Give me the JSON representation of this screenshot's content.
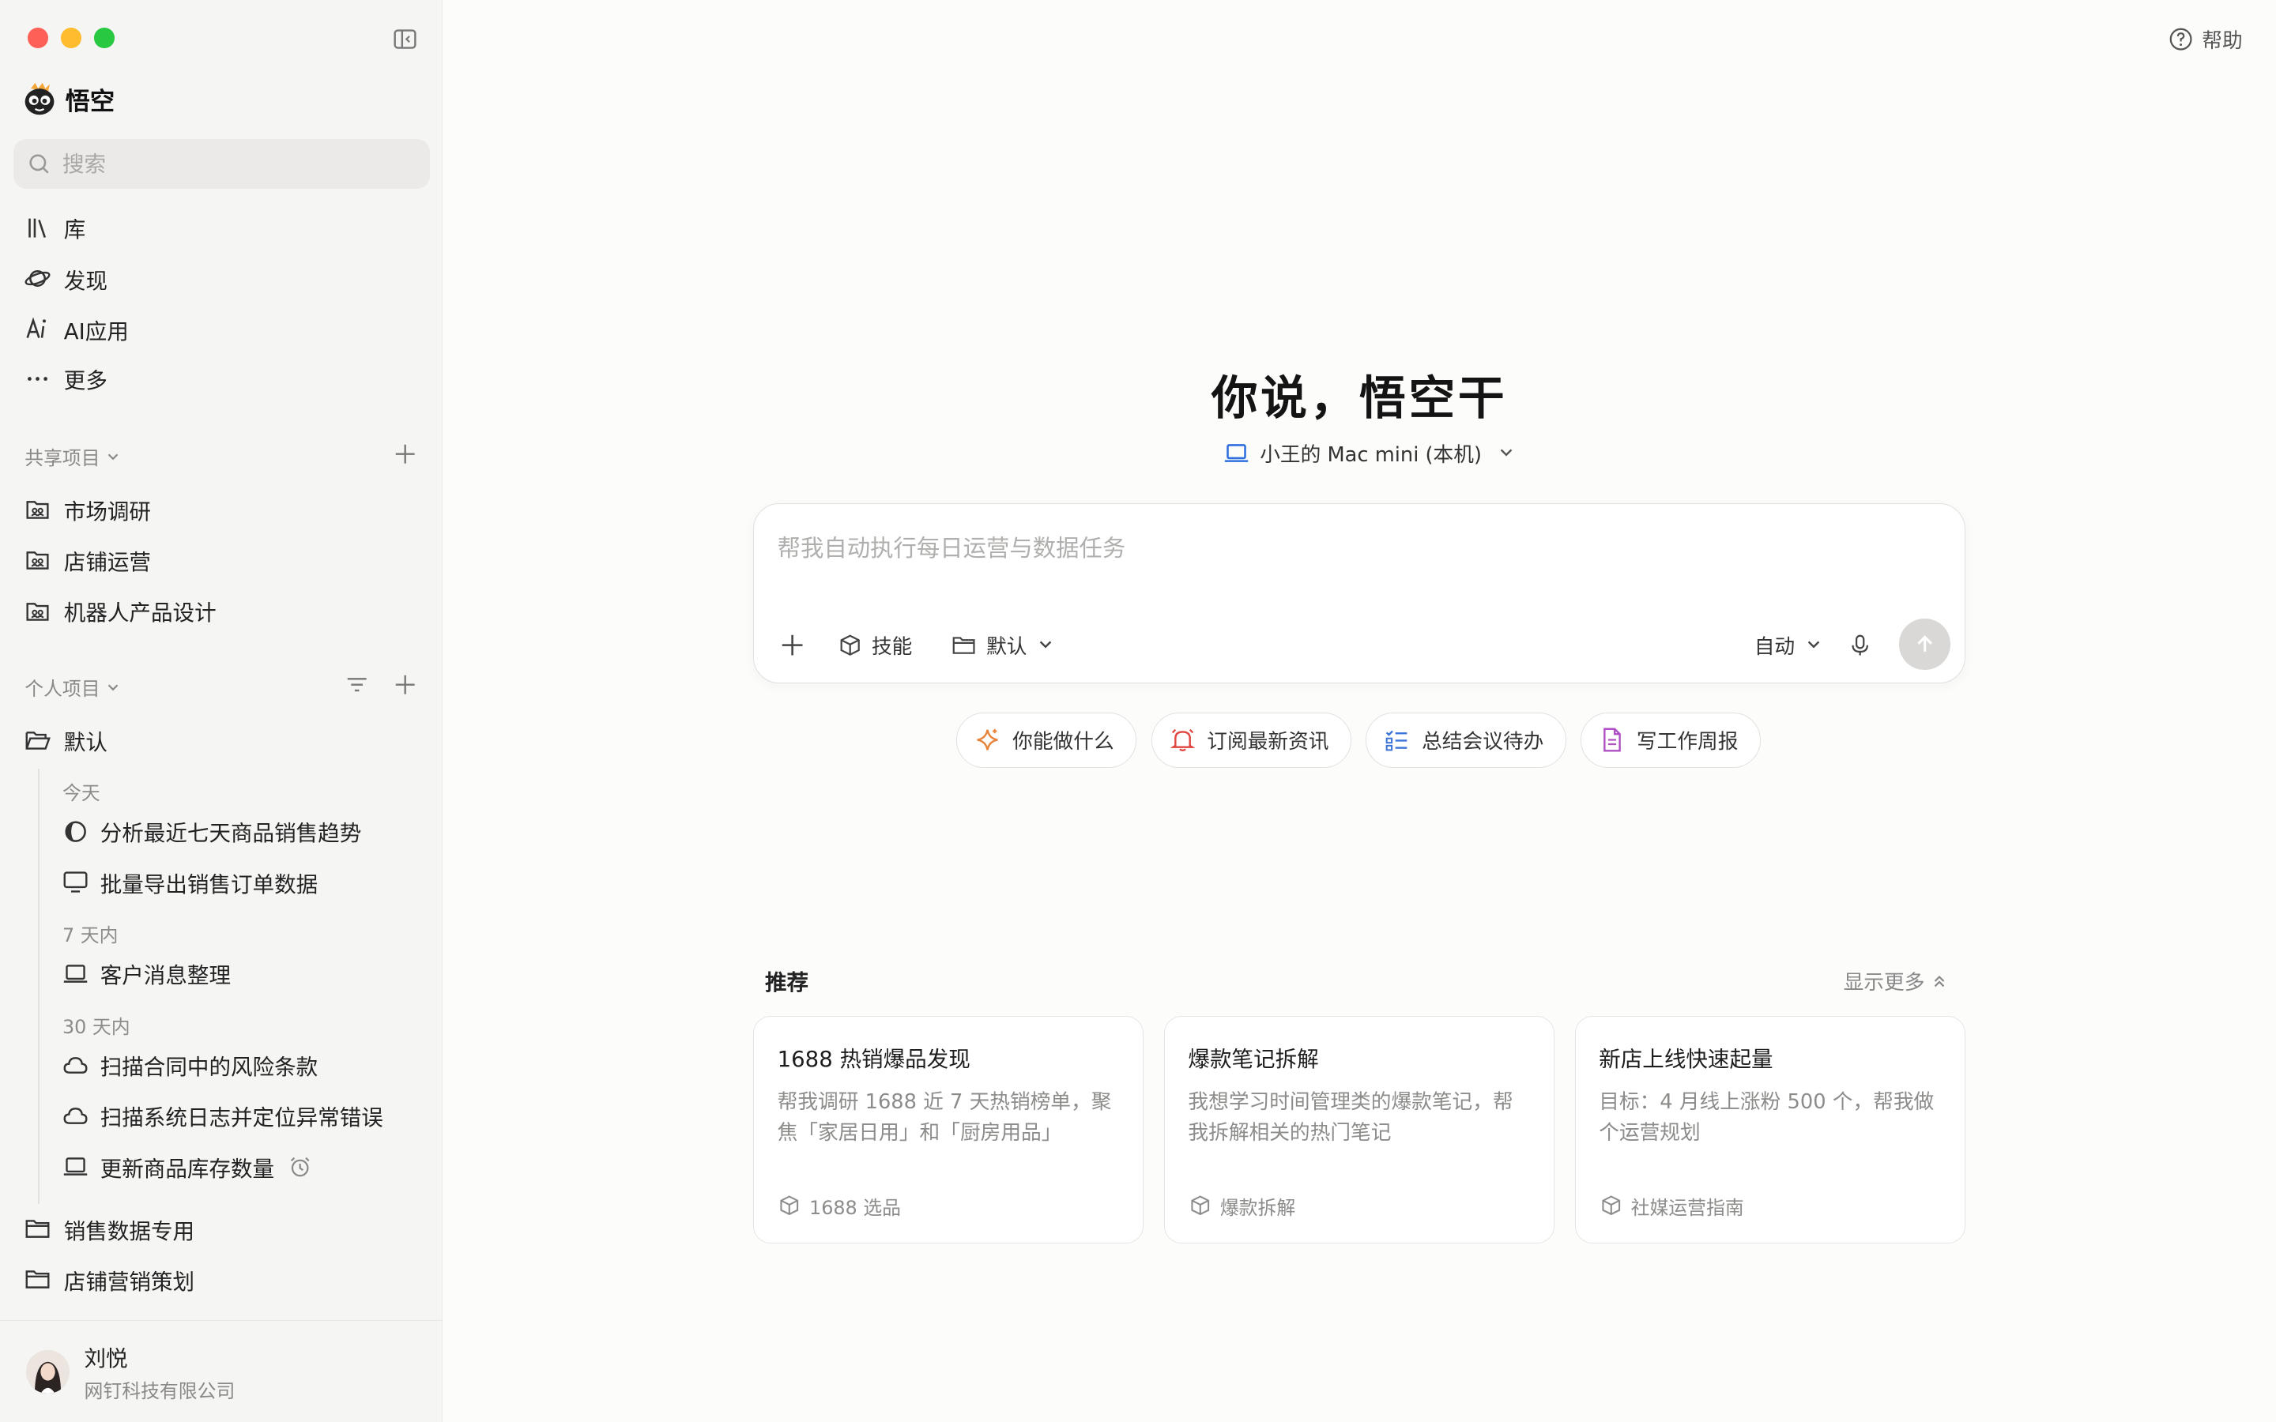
{
  "brand": {
    "name": "悟空"
  },
  "search": {
    "placeholder": "搜索"
  },
  "nav": [
    {
      "label": "库",
      "icon": "library-icon"
    },
    {
      "label": "发现",
      "icon": "planet-icon"
    },
    {
      "label": "AI应用",
      "icon": "ai-app-icon"
    },
    {
      "label": "更多",
      "icon": "more-icon"
    }
  ],
  "shared": {
    "title": "共享项目",
    "items": [
      "市场调研",
      "店铺运营",
      "机器人产品设计"
    ]
  },
  "personal": {
    "title": "个人项目",
    "default_folder": "默认",
    "groups": [
      {
        "label": "今天",
        "tasks": [
          "分析最近七天商品销售趋势",
          "批量导出销售订单数据"
        ]
      },
      {
        "label": "7 天内",
        "tasks": [
          "客户消息整理"
        ]
      },
      {
        "label": "30 天内",
        "tasks": [
          "扫描合同中的风险条款",
          "扫描系统日志并定位异常错误",
          "更新商品库存数量"
        ]
      }
    ],
    "folders": [
      "销售数据专用",
      "店铺营销策划"
    ]
  },
  "user": {
    "name": "刘悦",
    "org": "网钉科技有限公司"
  },
  "header": {
    "help": "帮助"
  },
  "hero": {
    "title": "你说，悟空干",
    "device": "小王的 Mac mini (本机)"
  },
  "composer": {
    "placeholder": "帮我自动执行每日运营与数据任务",
    "skills": "技能",
    "folder": "默认",
    "mode": "自动"
  },
  "chips": [
    "你能做什么",
    "订阅最新资讯",
    "总结会议待办",
    "写工作周报"
  ],
  "recommend": {
    "title": "推荐",
    "show_more": "显示更多",
    "cards": [
      {
        "title": "1688 热销爆品发现",
        "desc": "帮我调研 1688 近 7 天热销榜单，聚焦「家居日用」和「厨房用品」",
        "tag": "1688 选品"
      },
      {
        "title": "爆款笔记拆解",
        "desc": "我想学习时间管理类的爆款笔记，帮我拆解相关的热门笔记",
        "tag": "爆款拆解"
      },
      {
        "title": "新店上线快速起量",
        "desc": "目标：4 月线上涨粉 500 个，帮我做个运营规划",
        "tag": "社媒运营指南"
      }
    ]
  },
  "colors": {
    "accent_blue": "#2f6fde",
    "chip_orange": "#e8843a",
    "chip_red": "#e0463f",
    "chip_blue": "#3b73d9",
    "chip_purple": "#b04fc4"
  }
}
